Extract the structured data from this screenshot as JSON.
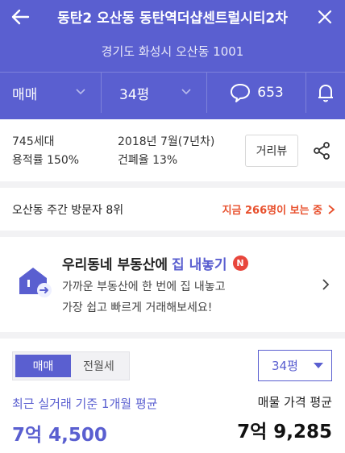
{
  "header": {
    "title": "동탄2 오산동 동탄역더샵센트럴시티2차",
    "address": "경기도 화성시 오산동 1001",
    "trade_type": "매매",
    "size": "34평",
    "comment_count": "653",
    "background_color": "#5a5fd0"
  },
  "info": {
    "households": "745세대",
    "floor_area_ratio": "용적률 150%",
    "built": "2018년 7월(7년차)",
    "building_coverage": "건폐율 13%",
    "distance_view_label": "거리뷰"
  },
  "visits": {
    "rank_text": "오산동 주간 방문자 8위",
    "watching_text": "지금 266명이 보는 중",
    "accent_color": "#e8502d"
  },
  "promo": {
    "title_prefix": "우리동네 부동산에",
    "title_highlight": "집 내놓기",
    "badge": "N",
    "desc_line1": "가까운 부동산에 한 번에 집 내놓고",
    "desc_line2": "가장 쉽고 빠르게 거래해보세요!"
  },
  "price": {
    "tabs": [
      "매매",
      "전월세"
    ],
    "active_tab": "매매",
    "size_select": "34평",
    "recent_label": "최근 실거래 기준 1개월 평균",
    "recent_value": "7억 4,500",
    "avg_label": "매물 가격 평균",
    "avg_value": "7억 9,285"
  }
}
